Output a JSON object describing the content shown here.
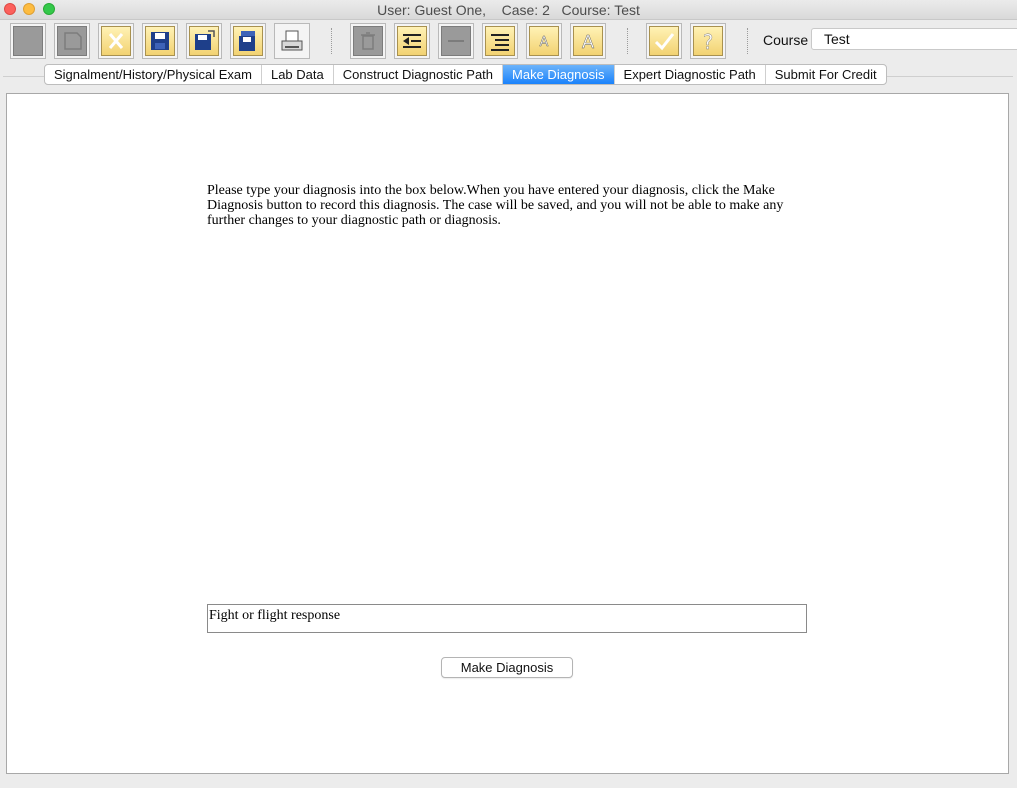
{
  "window": {
    "title": "User: Guest One,    Case: 2   Course: Test"
  },
  "toolbar": {
    "buttons": [
      {
        "name": "blank-page-icon",
        "enabled": false
      },
      {
        "name": "folded-page-icon",
        "enabled": false
      },
      {
        "name": "close-case-icon",
        "enabled": true
      },
      {
        "name": "save-icon",
        "enabled": true
      },
      {
        "name": "save-as-icon",
        "enabled": true
      },
      {
        "name": "save-all-icon",
        "enabled": true
      },
      {
        "name": "print-icon",
        "enabled": true
      },
      {
        "name": "trash-icon",
        "enabled": false
      },
      {
        "name": "collapse-icon",
        "enabled": true
      },
      {
        "name": "remove-icon",
        "enabled": false
      },
      {
        "name": "list-icon",
        "enabled": true
      },
      {
        "name": "font-smaller-icon",
        "enabled": true
      },
      {
        "name": "font-larger-icon",
        "enabled": true
      },
      {
        "name": "check-icon",
        "enabled": true
      },
      {
        "name": "help-icon",
        "enabled": true
      }
    ],
    "course_label": "Course",
    "course_value": "Test"
  },
  "tabs": [
    {
      "label": "Signalment/History/Physical Exam",
      "active": false
    },
    {
      "label": "Lab Data",
      "active": false
    },
    {
      "label": "Construct Diagnostic Path",
      "active": false
    },
    {
      "label": "Make Diagnosis",
      "active": true
    },
    {
      "label": "Expert Diagnostic Path",
      "active": false
    },
    {
      "label": "Submit For Credit",
      "active": false
    }
  ],
  "main": {
    "instructions": "Please type your diagnosis into the box below.When you have entered your diagnosis, click the Make Diagnosis button to record this diagnosis. The case will be saved, and you will not be able to make any further changes to your diagnostic path or diagnosis.",
    "diagnosis_value": "Fight or flight response",
    "make_diagnosis_label": "Make Diagnosis"
  },
  "colors": {
    "active_tab": "#1a82fb",
    "toolbar_icon_yellow": "#f2d272",
    "disabled_icon": "#9a9a9a"
  }
}
